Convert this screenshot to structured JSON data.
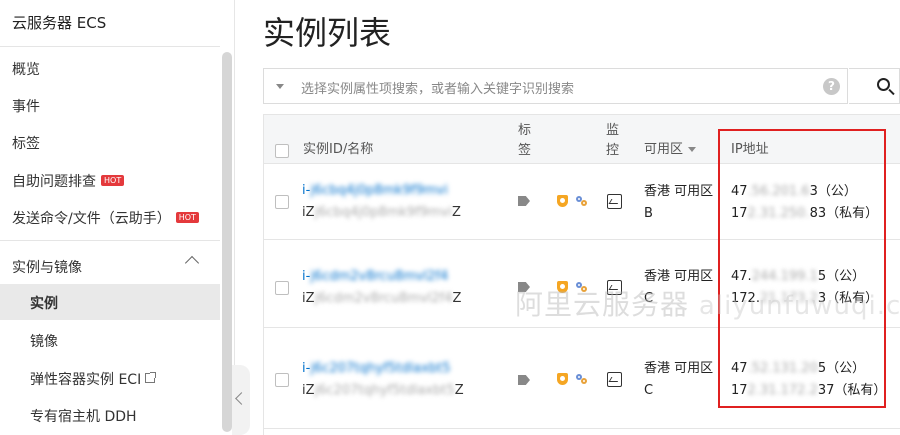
{
  "sidebar": {
    "title": "云服务器 ECS",
    "items": [
      {
        "label": "概览"
      },
      {
        "label": "事件"
      },
      {
        "label": "标签"
      },
      {
        "label": "自助问题排查",
        "badge": "HOT"
      },
      {
        "label": "发送命令/文件（云助手）",
        "badge": "HOT"
      }
    ],
    "group": {
      "label": "实例与镜像",
      "items": [
        {
          "label": "实例",
          "active": true
        },
        {
          "label": "镜像"
        },
        {
          "label": "弹性容器实例 ECI",
          "external": true
        },
        {
          "label": "专有宿主机 DDH"
        }
      ]
    }
  },
  "main": {
    "title": "实例列表",
    "search": {
      "placeholder": "选择实例属性项搜索，或者输入关键字识别搜索",
      "help": "?"
    }
  },
  "table": {
    "headers": {
      "id_name": "实例ID/名称",
      "tags_1": "标",
      "tags_2": "签",
      "monitor_1": "监",
      "monitor_2": "控",
      "zone": "可用区",
      "ip": "IP地址"
    },
    "rows": [
      {
        "id_prefix": "i-",
        "id_masked": "j6cbq4j0p8mk9f9mvi",
        "name_prefix": "iZ",
        "name_masked": "j6cbq4j0p8mk9f9mvi",
        "name_suffix": "Z",
        "zone_line1": "香港 可用区",
        "zone_line2": "B",
        "ip_public_a": "47",
        "ip_public_masked": ".56.201.6",
        "ip_public_b": "3（公）",
        "ip_private_a": "17",
        "ip_private_masked": "2.31.250.",
        "ip_private_b": "83（私有）"
      },
      {
        "id_prefix": "i-",
        "id_masked": "j6cdm2v8rcu8mvl2f4",
        "name_prefix": "iZ",
        "name_masked": "j6cdm2v8rcu8mvl2f4",
        "name_suffix": "Z",
        "zone_line1": "香港 可用区",
        "zone_line2": "C",
        "ip_public_a": "47.",
        "ip_public_masked": "244.199.1",
        "ip_public_b": "5（公）",
        "ip_private_a": "172.",
        "ip_private_masked": "21.173.2",
        "ip_private_b": "3（私有）"
      },
      {
        "id_prefix": "i-",
        "id_masked": "j6c207tqhyf5tdlaxbt5",
        "name_prefix": "iZ",
        "name_masked": "j6c207tqhyf5tdlaxbt5",
        "name_suffix": "Z",
        "zone_line1": "香港 可用区",
        "zone_line2": "C",
        "ip_public_a": "47",
        "ip_public_masked": ".52.131.20",
        "ip_public_b": "5（公）",
        "ip_private_a": "17",
        "ip_private_masked": "2.31.172.2",
        "ip_private_b": "37（私有）"
      }
    ]
  },
  "watermark": {
    "cn": "阿里云服务器",
    "en": "aliyunfuwuqi.com"
  },
  "colors": {
    "highlight": "#e02020",
    "link": "#0070cc",
    "hot_badge": "#e4393c"
  }
}
